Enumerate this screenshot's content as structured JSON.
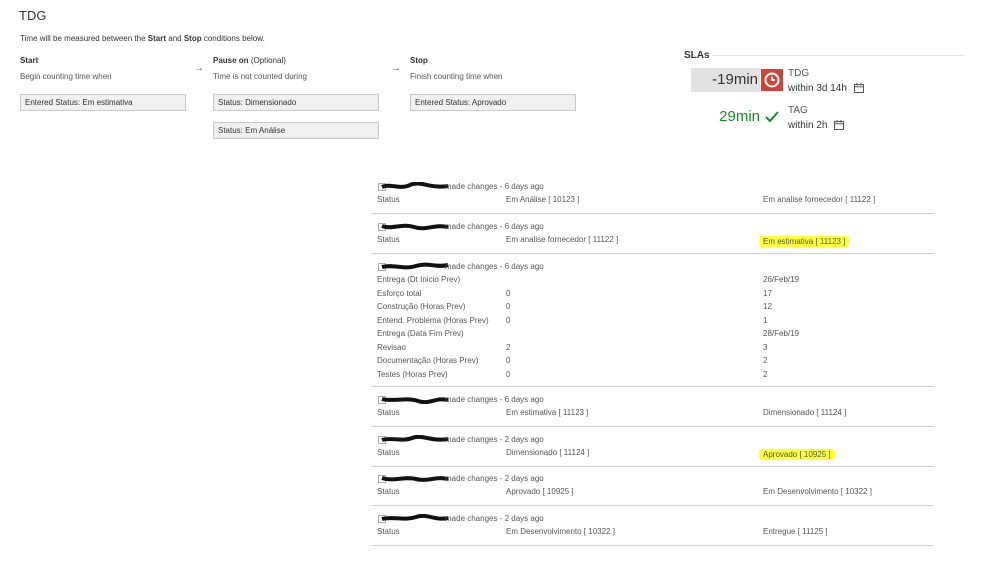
{
  "page": {
    "title": "TDG",
    "intro_prefix": "Time will be measured between the",
    "intro_start": "Start",
    "intro_and": "and",
    "intro_stop": "Stop",
    "intro_suffix": "conditions below."
  },
  "conditions": {
    "start": {
      "heading": "Start",
      "sub": "Begin counting time when",
      "items": [
        "Entered Status: Em estimativa"
      ]
    },
    "pause": {
      "heading": "Pause on",
      "optional": "(Optional)",
      "sub": "Time is not counted during",
      "items": [
        "Status: Dimensionado",
        "Status: Em Análise"
      ]
    },
    "stop": {
      "heading": "Stop",
      "sub": "Finish counting time when",
      "items": [
        "Entered Status: Aprovado"
      ]
    },
    "arrow": "→"
  },
  "slas": {
    "title": "SLAs",
    "items": [
      {
        "value": "-19min",
        "name": "TDG",
        "within": "within 3d 14h",
        "state": "breached",
        "color": "#d04437",
        "icon": "clock-icon"
      },
      {
        "value": "29min",
        "name": "TAG",
        "within": "within 2h",
        "state": "met",
        "color": "#14892c",
        "icon": "check-icon"
      }
    ]
  },
  "history": [
    {
      "action": "made changes - 6 days ago",
      "rows": [
        {
          "field": "Status",
          "old": "Em Análise [ 10123 ]",
          "new": "Em analise fornecedor [ 11122 ]"
        }
      ]
    },
    {
      "action": "made changes - 6 days ago",
      "rows": [
        {
          "field": "Status",
          "old": "Em analise fornecedor [ 11122 ]",
          "new": "Em estimativa [ 11123 ]",
          "highlight": true
        }
      ]
    },
    {
      "action": "made changes - 6 days ago",
      "rows": [
        {
          "field": "Entrega (Dt Inicio Prev)",
          "old": "",
          "new": "26/Feb/19"
        },
        {
          "field": "Esforço total",
          "old": "0",
          "new": "17"
        },
        {
          "field": "Construção (Horas Prev)",
          "old": "0",
          "new": "12"
        },
        {
          "field": "Entend. Problema (Horas Prev)",
          "old": "0",
          "new": "1"
        },
        {
          "field": "Entrega (Data Fim Prev)",
          "old": "",
          "new": "28/Feb/19"
        },
        {
          "field": "Revisao",
          "old": "2",
          "new": "3"
        },
        {
          "field": "Documentação (Horas Prev)",
          "old": "0",
          "new": "2"
        },
        {
          "field": "Testes (Horas Prev)",
          "old": "0",
          "new": "2"
        }
      ]
    },
    {
      "action": "made changes - 6 days ago",
      "rows": [
        {
          "field": "Status",
          "old": "Em estimativa [ 11123 ]",
          "new": "Dimensionado [ 11124 ]"
        }
      ]
    },
    {
      "action": "made changes - 2 days ago",
      "rows": [
        {
          "field": "Status",
          "old": "Dimensionado [ 11124 ]",
          "new": "Aprovado [ 10925 ]",
          "highlight": true
        }
      ]
    },
    {
      "action": "made changes - 2 days ago",
      "rows": [
        {
          "field": "Status",
          "old": "Aprovado [ 10925 ]",
          "new": "Em Desenvolvimento [ 10322 ]"
        }
      ]
    },
    {
      "action": "made changes - 2 days ago",
      "rows": [
        {
          "field": "Status",
          "old": "Em Desenvolvimento [ 10322 ]",
          "new": "Entregue [ 11125 ]"
        }
      ]
    }
  ],
  "colors": {
    "highlight": "#ffff38",
    "redacted": "#111111"
  }
}
